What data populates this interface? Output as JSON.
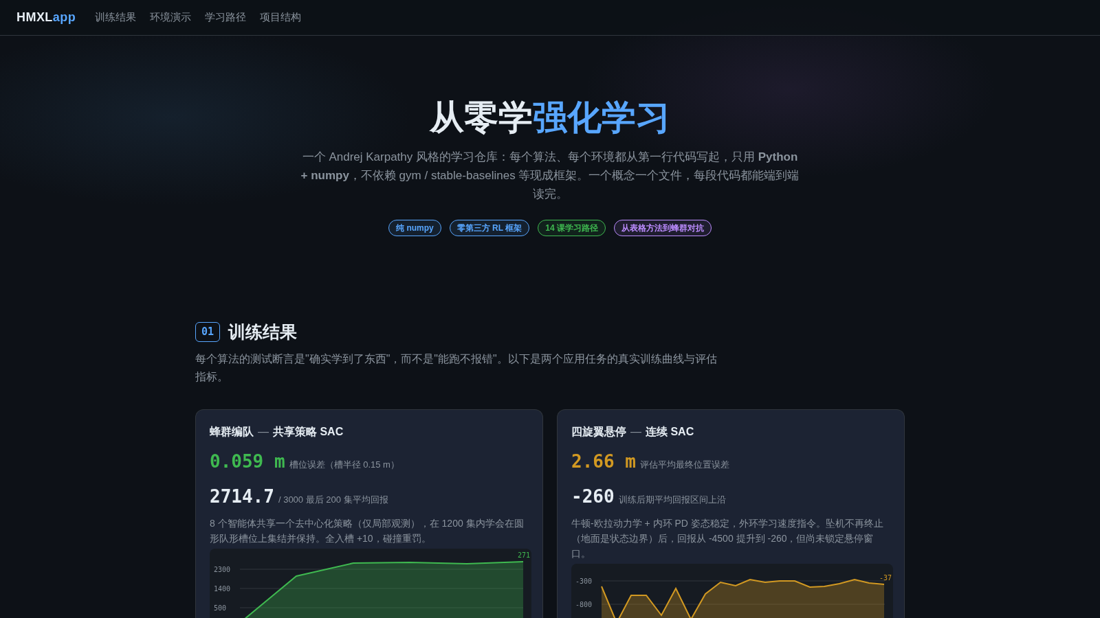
{
  "nav": {
    "logo_main": "HMXL",
    "logo_accent": "app",
    "links": [
      "训练结果",
      "环境演示",
      "学习路径",
      "项目结构"
    ]
  },
  "hero": {
    "title_main": "从零学",
    "title_accent": "强化学习",
    "intro": "一个 Andrej Karpathy 风格的学习仓库：每个算法、每个环境都从第一行代码写起，只用 **Python + numpy**，不依赖 gym / stable-baselines 等现成框架。一个概念一个文件，每段代码都能端到端读完。",
    "tags": [
      {
        "label": "纯 numpy",
        "color": "#58a6ff"
      },
      {
        "label": "零第三方 RL 框架",
        "color": "#58a6ff"
      },
      {
        "label": "14 课学习路径",
        "color": "#3fb950"
      },
      {
        "label": "从表格方法到蜂群对抗",
        "color": "#bc8cff"
      }
    ]
  },
  "section": {
    "number": "01",
    "title": "训练结果",
    "description": "每个算法的测试断言是\"确实学到了东西\"，而不是\"能跑不报错\"。以下是两个应用任务的真实训练曲线与评估指标。"
  },
  "cards": [
    {
      "title_main": "蜂群编队",
      "separator": "—",
      "title_sub": "共享策略 SAC",
      "color": "#3fb950",
      "metric": "0.059 m",
      "metric_note": "槽位误差（槽半径 0.15 m）",
      "score": "2714.7",
      "score_note": "/ 3000 最后 200 集平均回报",
      "description": "8 个智能体共享一个去中心化策略（仅局部观测），在 1200 集内学会在圆形队形槽位上集结并保持。全入槽 +10，碰撞重罚。",
      "chart": {
        "tick_labels": [
          "2300",
          "1400",
          "500"
        ],
        "end_label": "271"
      }
    },
    {
      "title_main": "四旋翼悬停",
      "separator": "—",
      "title_sub": "连续 SAC",
      "color": "#d29922",
      "metric": "2.66 m",
      "metric_note": "评估平均最终位置误差",
      "score": "-260",
      "score_note": "训练后期平均回报区间上沿",
      "description": "牛顿-欧拉动力学 + 内环 PD 姿态稳定，外环学习速度指令。坠机不再终止（地面是状态边界）后，回报从 -4500 提升到 -260，但尚未锁定悬停窗口。",
      "chart": {
        "tick_labels": [
          "-300",
          "-800"
        ],
        "end_label": "-37"
      }
    }
  ]
}
